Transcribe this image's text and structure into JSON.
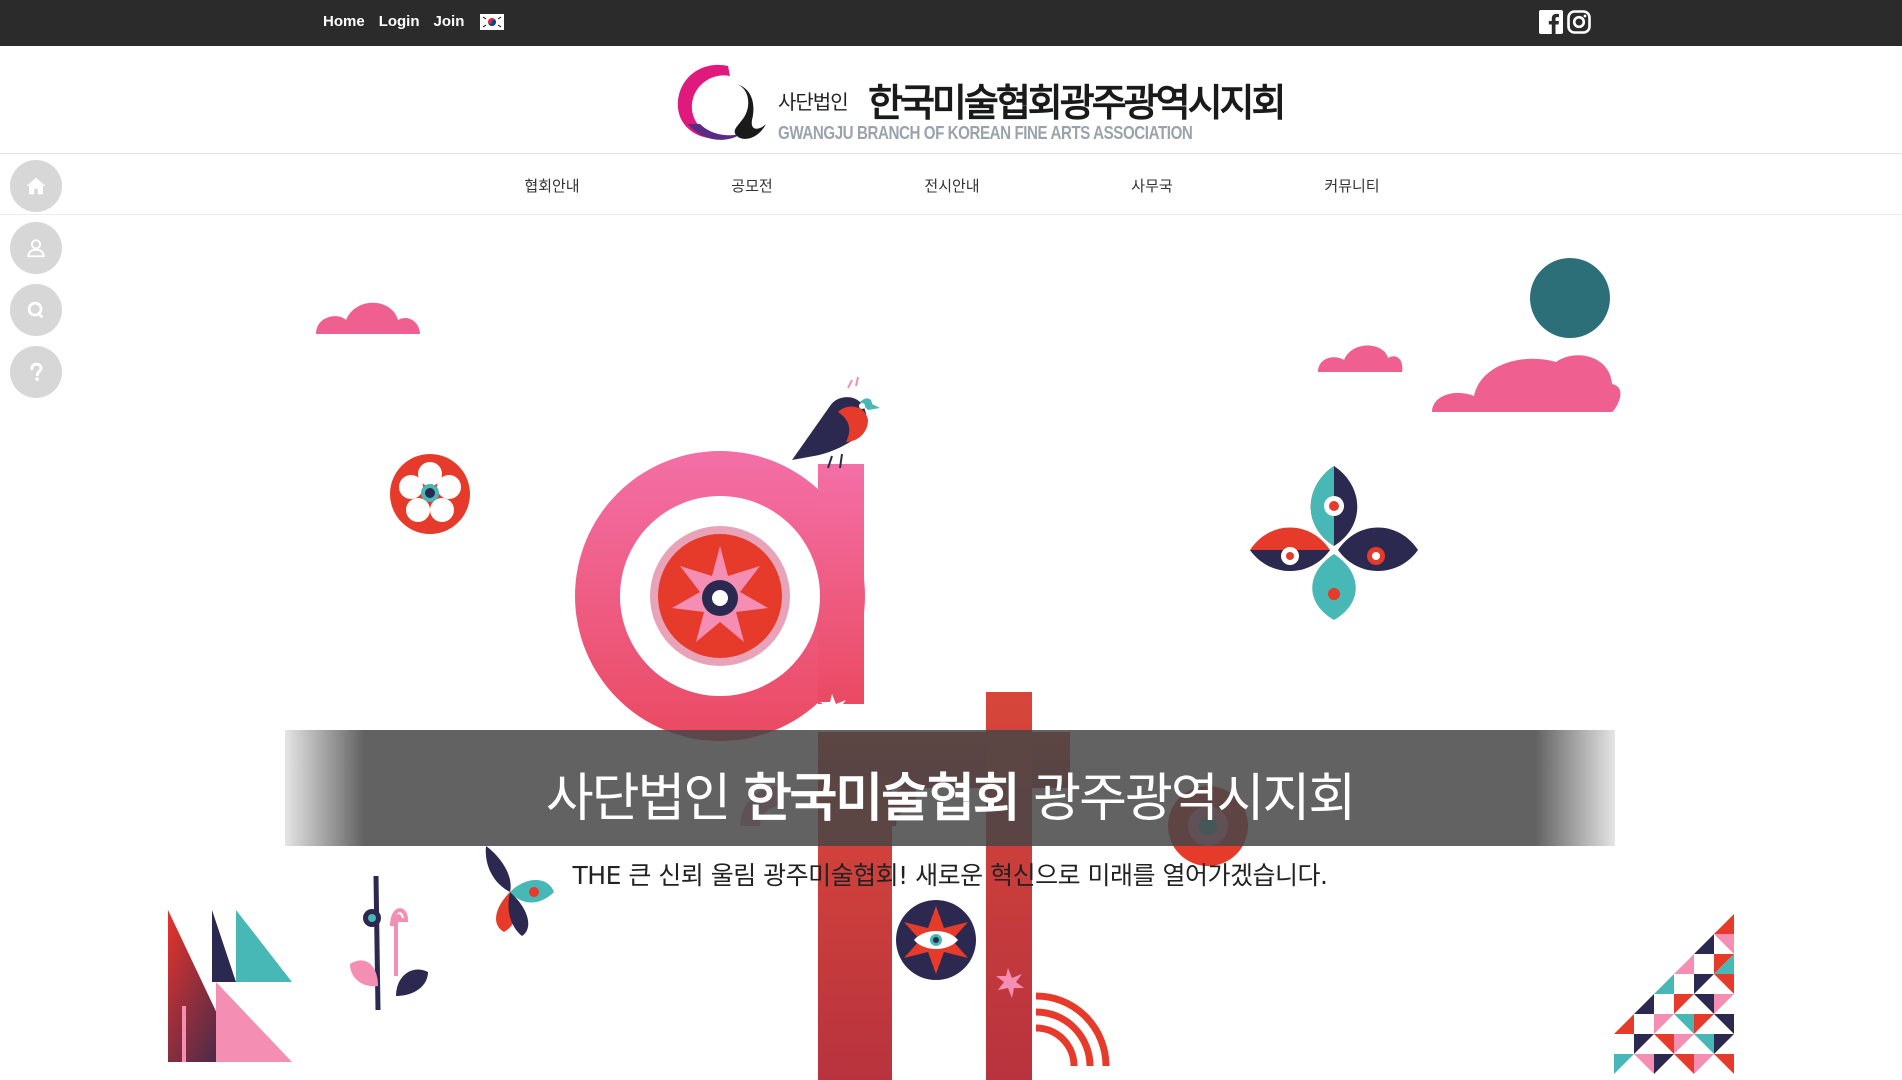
{
  "topbar": {
    "links": [
      "Home",
      "Login",
      "Join"
    ],
    "flag_icon": "korea-flag-icon",
    "social_icons": [
      "facebook-icon",
      "instagram-icon"
    ]
  },
  "logo": {
    "small_text": "사단법인",
    "big_text": "한국미술협회광주광역시지회",
    "english_text": "GWANGJU BRANCH OF KOREAN FINE ARTS ASSOCIATION",
    "brand_colors": [
      "#e0197d",
      "#5b2a86",
      "#1a1a1a",
      "#9aa3ac"
    ]
  },
  "nav": {
    "items": [
      "협회안내",
      "공모전",
      "전시안내",
      "사무국",
      "커뮤니티"
    ]
  },
  "quick_menu": {
    "items": [
      "home-icon",
      "user-icon",
      "search-icon",
      "question-icon"
    ]
  },
  "hero": {
    "title_pre": "사단법인",
    "title_bold": "한국미술협회",
    "title_post": "광주광역시지회",
    "subtitle": "THE 큰 신뢰 울림 광주미술협회! 새로운 혁신으로 미래를 열어가겠습니다.",
    "colors": {
      "pink": "#f0568f",
      "light_pink": "#f48fb3",
      "red": "#e63a2a",
      "navy": "#2b2950",
      "teal": "#48b8b6",
      "dark_red": "#c4343b"
    }
  }
}
